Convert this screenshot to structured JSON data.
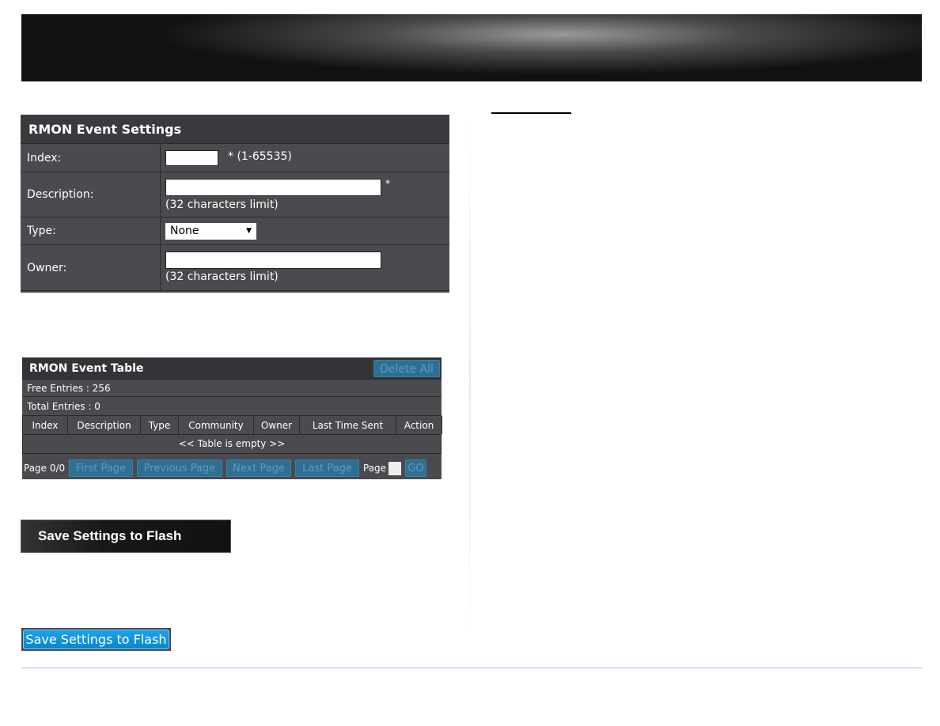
{
  "settings": {
    "title": "RMON Event Settings",
    "index": {
      "label": "Index:",
      "value": "",
      "hint": "* (1-65535)"
    },
    "description": {
      "label": "Description:",
      "value": "",
      "required": "*",
      "hint": "(32 characters limit)"
    },
    "type": {
      "label": "Type:",
      "selected": "None"
    },
    "owner": {
      "label": "Owner:",
      "value": "",
      "hint": "(32 characters limit)"
    }
  },
  "table": {
    "title": "RMON Event Table",
    "delete_all": "Delete All",
    "free_entries": "Free Entries : 256",
    "total_entries": "Total Entries : 0",
    "columns": [
      "Index",
      "Description",
      "Type",
      "Community",
      "Owner",
      "Last Time Sent",
      "Action"
    ],
    "empty": "<< Table is empty >>",
    "pagination": {
      "page_info": "Page 0/0",
      "first": "First Page",
      "previous": "Previous Page",
      "next": "Next Page",
      "last": "Last Page",
      "page_label": "Page",
      "page_value": "",
      "go": "GO"
    }
  },
  "buttons": {
    "save_dark": "Save Settings to Flash",
    "save_blue": "Save Settings to Flash"
  },
  "colors": {
    "panel": "#4a4b4f",
    "accent_blue": "#0a86cc",
    "footer_line": "#9fc3e8"
  }
}
